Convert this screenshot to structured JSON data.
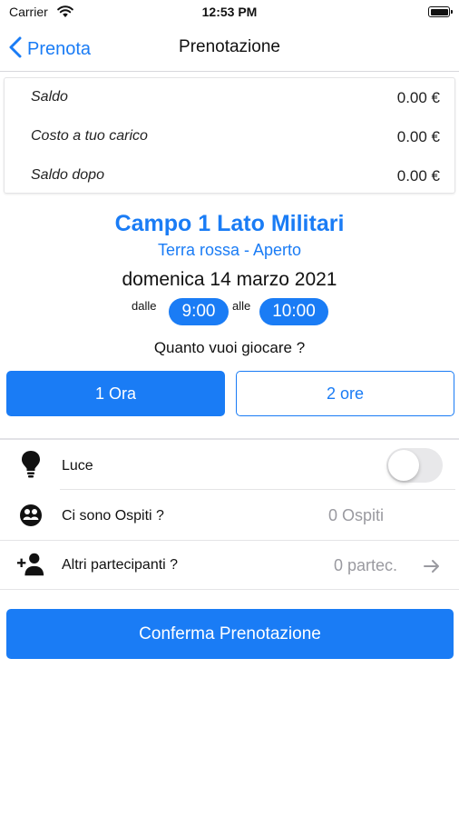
{
  "status_bar": {
    "carrier": "Carrier",
    "time": "12:53 PM"
  },
  "nav": {
    "back_label": "Prenota",
    "title": "Prenotazione"
  },
  "summary": {
    "rows": [
      {
        "label": "Saldo",
        "value": "0.00 €"
      },
      {
        "label": "Costo a tuo carico",
        "value": "0.00 €"
      },
      {
        "label": "Saldo dopo",
        "value": "0.00 €"
      }
    ]
  },
  "court": {
    "name": "Campo 1 Lato Militari",
    "subtitle": "Terra rossa - Aperto"
  },
  "booking": {
    "date": "domenica 14 marzo 2021",
    "from_label": "dalle",
    "start_time": "9:00",
    "to_label": "alle",
    "end_time": "10:00",
    "question": "Quanto vuoi giocare ?"
  },
  "duration_options": [
    {
      "label": "1 Ora",
      "selected": true
    },
    {
      "label": "2 ore",
      "selected": false
    }
  ],
  "options": {
    "light": {
      "label": "Luce",
      "enabled": false,
      "icon": "lightbulb-icon"
    },
    "guests": {
      "label": "Ci sono Ospiti ?",
      "value": "0 Ospiti",
      "icon": "guests-icon"
    },
    "participants": {
      "label": "Altri partecipanti ?",
      "value": "0 partec.",
      "icon": "add-person-icon",
      "arrow_icon": "arrow-right-icon"
    }
  },
  "confirm_label": "Conferma Prenotazione",
  "colors": {
    "accent": "#1a7cf5",
    "toggle_off": "#e8e8ea"
  }
}
